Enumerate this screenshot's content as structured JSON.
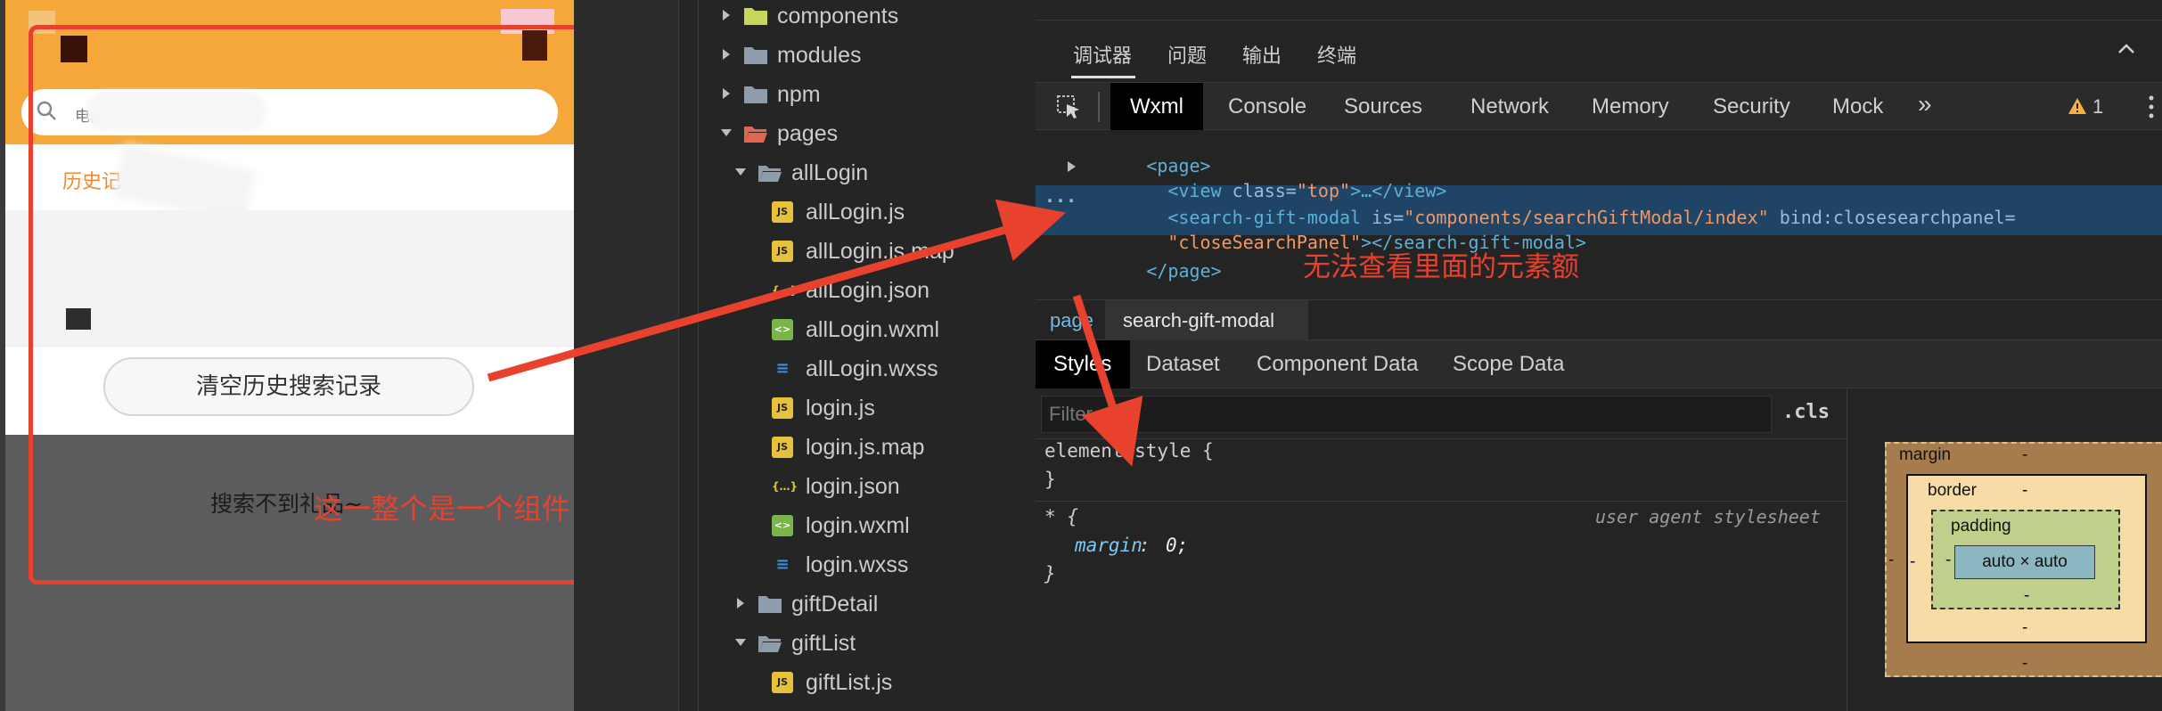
{
  "simulator": {
    "search_placeholder": "电品...",
    "history_title": "历史记",
    "clear_button": "清空历史搜索记录",
    "empty_text": "搜索不到礼品~",
    "colors": {
      "header": "#f5a73a",
      "accent": "#f08a2c"
    }
  },
  "file_tree": {
    "items": [
      {
        "label": "components",
        "type": "folder",
        "icon": "folder-icon"
      },
      {
        "label": "modules",
        "type": "folder",
        "icon": "folder-icon"
      },
      {
        "label": "npm",
        "type": "folder",
        "icon": "folder-icon"
      },
      {
        "label": "pages",
        "type": "folder-open",
        "icon": "folder-open-icon"
      },
      {
        "label": "allLogin",
        "type": "folder-open",
        "icon": "folder-open-icon"
      },
      {
        "label": "allLogin.js",
        "type": "js",
        "icon": "js-file-icon"
      },
      {
        "label": "allLogin.js.map",
        "type": "js-map",
        "icon": "js-map-file-icon"
      },
      {
        "label": "allLogin.json",
        "type": "json",
        "icon": "json-file-icon"
      },
      {
        "label": "allLogin.wxml",
        "type": "wxml",
        "icon": "wxml-file-icon"
      },
      {
        "label": "allLogin.wxss",
        "type": "wxss",
        "icon": "wxss-file-icon"
      },
      {
        "label": "login.js",
        "type": "js",
        "icon": "js-file-icon"
      },
      {
        "label": "login.js.map",
        "type": "js-map",
        "icon": "js-map-file-icon"
      },
      {
        "label": "login.json",
        "type": "json",
        "icon": "json-file-icon"
      },
      {
        "label": "login.wxml",
        "type": "wxml",
        "icon": "wxml-file-icon"
      },
      {
        "label": "login.wxss",
        "type": "wxss",
        "icon": "wxss-file-icon"
      },
      {
        "label": "giftDetail",
        "type": "folder",
        "icon": "folder-icon"
      },
      {
        "label": "giftList",
        "type": "folder-open",
        "icon": "folder-open-icon"
      },
      {
        "label": "giftList.js",
        "type": "js",
        "icon": "js-file-icon"
      }
    ]
  },
  "devtools": {
    "top_tabs": [
      "调试器",
      "问题",
      "输出",
      "终端"
    ],
    "panel_tabs": [
      "Wxml",
      "Console",
      "Sources",
      "Network",
      "Memory",
      "Security",
      "Mock"
    ],
    "more": "»",
    "warning_count": "1",
    "dom": {
      "page_open": "<page>",
      "view_tag": "<view",
      "view_attr": " class=",
      "view_val": "\"top\"",
      "view_close": ">…</view>",
      "sgm_tag": "<search-gift-modal",
      "sgm_attr_is": " is=",
      "sgm_val_is": "\"components/searchGiftModal/index\"",
      "sgm_attr_bind": " bind:closesearchpanel=",
      "sgm_val_bind": "\"closeSearchPanel\"",
      "sgm_close": "></search-gift-modal>",
      "page_close": "</page>",
      "ellipsis": "..."
    },
    "note_inspect": "无法查看里面的元素额",
    "breadcrumb": [
      "page",
      "search-gift-modal"
    ],
    "style_tabs": [
      "Styles",
      "Dataset",
      "Component Data",
      "Scope Data"
    ],
    "filter_placeholder": "Filter",
    "cls": ".cls",
    "css": {
      "element_style": "element.style {",
      "brace_close": "}",
      "universal": "* {",
      "ua": "user agent stylesheet",
      "prop": "margin",
      "prop_val": "0;"
    },
    "box_model": {
      "margin": "margin",
      "border": "border",
      "padding": "padding",
      "content": "auto × auto",
      "dash": "-"
    }
  },
  "annotations": {
    "component_note": "这一整个是一个组件",
    "color": "#e8412d"
  }
}
